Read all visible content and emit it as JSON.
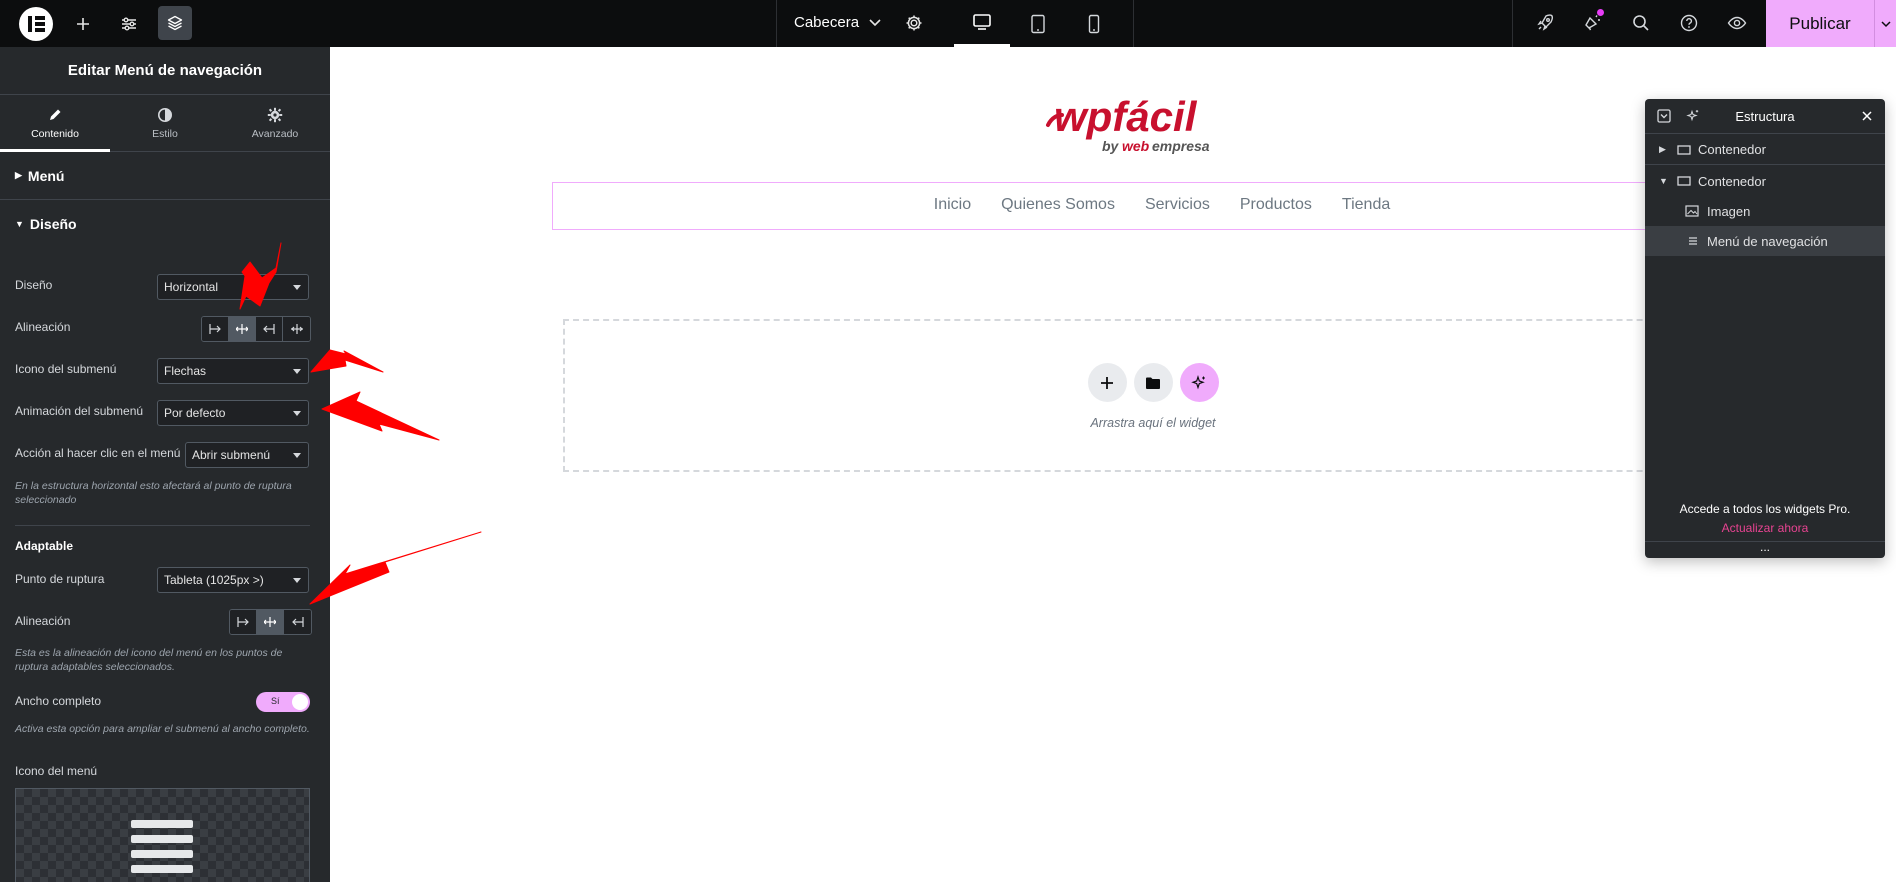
{
  "topbar": {
    "document_title": "Cabecera",
    "publish_label": "Publicar",
    "icons": [
      "elementor-logo-icon",
      "plus-icon",
      "sliders-icon",
      "layers-icon",
      "chevron-down-icon",
      "gear-icon",
      "desktop-icon",
      "tablet-icon",
      "mobile-icon",
      "rocket-icon",
      "whats-new-icon",
      "search-icon",
      "help-icon",
      "eye-icon",
      "caret-down-icon"
    ]
  },
  "panel": {
    "title": "Editar Menú de navegación",
    "tabs": [
      {
        "label": "Contenido",
        "icon": "pencil-icon",
        "active": true
      },
      {
        "label": "Estilo",
        "icon": "half-circle-icon",
        "active": false
      },
      {
        "label": "Avanzado",
        "icon": "gear-icon",
        "active": false
      }
    ],
    "section_menu": "Menú",
    "section_design": "Diseño",
    "controls": {
      "layout_label": "Diseño",
      "layout_value": "Horizontal",
      "align_label": "Alineación",
      "submenu_icon_label": "Icono del submenú",
      "submenu_icon_value": "Flechas",
      "submenu_anim_label": "Animación del submenú",
      "submenu_anim_value": "Por defecto",
      "click_action_label": "Acción al hacer clic en el menú",
      "click_action_value": "Abrir submenú",
      "click_action_help": "En la estructura horizontal esto afectará al punto de ruptura seleccionado",
      "responsive_heading": "Adaptable",
      "breakpoint_label": "Punto de ruptura",
      "breakpoint_value": "Tableta (1025px >)",
      "responsive_align_label": "Alineación",
      "responsive_align_help": "Esta es la alineación del icono del menú en los puntos de ruptura adaptables seleccionados.",
      "full_width_label": "Ancho completo",
      "full_width_toggle": "Sí",
      "full_width_help": "Activa esta opción para ampliar el submenú al ancho completo.",
      "menu_icon_label": "Icono del menú"
    }
  },
  "canvas": {
    "logo_main": "wpfácil",
    "logo_sub_by": "by",
    "logo_sub_web": "web",
    "logo_sub_empresa": "empresa",
    "nav_items": [
      "Inicio",
      "Quienes Somos",
      "Servicios",
      "Productos",
      "Tienda"
    ],
    "dropzone_text": "Arrastra aquí el widget"
  },
  "structure": {
    "title": "Estructura",
    "items": [
      {
        "label": "Contenedor",
        "level": 0,
        "expanded": false
      },
      {
        "label": "Contenedor",
        "level": 0,
        "expanded": true
      },
      {
        "label": "Imagen",
        "level": 1
      },
      {
        "label": "Menú de navegación",
        "level": 1,
        "active": true
      }
    ],
    "promo_title": "Accede a todos los widgets Pro.",
    "promo_link": "Actualizar ahora",
    "more_dots": "..."
  },
  "colors": {
    "accent_pink": "#f0abfc",
    "panel_bg": "#26292c",
    "topbar_bg": "#0c0d0e",
    "promo_link": "#e74391",
    "annotation_red": "#ff0000",
    "logo_red": "#c8102e"
  }
}
